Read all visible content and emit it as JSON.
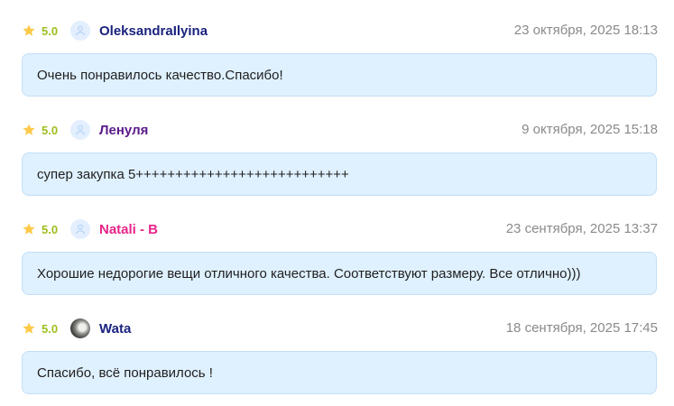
{
  "colors": {
    "rating": "#9cbf1e",
    "star": "#ffc94a",
    "bubble_bg": "#dff0ff",
    "bubble_border": "#c3dff7",
    "date": "#8a8a8a"
  },
  "reviews": [
    {
      "rating": "5.0",
      "icon": "star-icon",
      "avatar": "user-placeholder-icon",
      "username": "OleksandraIlyina",
      "username_color": "#1a237e",
      "date": "23 октября, 2025 18:13",
      "text": "Очень понравилось качество.Спасибо!"
    },
    {
      "rating": "5.0",
      "icon": "star-icon",
      "avatar": "user-placeholder-icon",
      "username": "Ленуля",
      "username_color": "#5b1a8a",
      "date": "9 октября, 2025 15:18",
      "text": "супер закупка 5+++++++++++++++++++++++++++"
    },
    {
      "rating": "5.0",
      "icon": "star-icon",
      "avatar": "user-placeholder-icon",
      "username": "Natali - B",
      "username_color": "#e8248a",
      "date": "23 сентября, 2025 13:37",
      "text": "Хорошие недорогие вещи отличного качества. Соответствуют размеру. Все отлично)))"
    },
    {
      "rating": "5.0",
      "icon": "star-icon",
      "avatar": "user-photo",
      "username": "Wata",
      "username_color": "#1a237e",
      "date": "18 сентября, 2025 17:45",
      "text": "Спасибо, всё понравилось !"
    }
  ]
}
